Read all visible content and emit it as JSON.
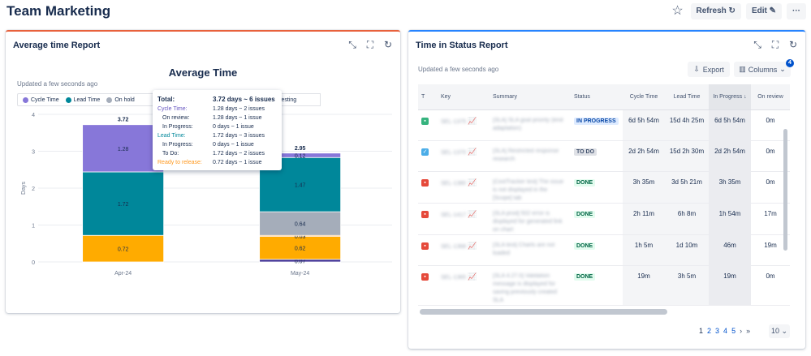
{
  "page": {
    "title": "Team Marketing",
    "refresh_label": "Refresh",
    "refresh_icon": "↻",
    "edit_label": "Edit",
    "edit_icon": "✎",
    "more_label": "···",
    "star_icon": "☆"
  },
  "average_report": {
    "panel_title": "Average time Report",
    "updated": "Updated a few seconds ago",
    "icons": [
      "collapse-icon",
      "fullscreen-icon",
      "refresh-icon"
    ],
    "legend": [
      {
        "label": "Cycle Time",
        "color": "#8777d9"
      },
      {
        "label": "Lead Time",
        "color": "#00879a"
      },
      {
        "label": "On hold",
        "color": "#a5adba"
      }
    ],
    "legend_last": {
      "label": "Testing",
      "color": "#403294"
    },
    "tooltip": {
      "total_label": "Total:",
      "total_value": "3.72 days ~ 6 issues",
      "rows": [
        {
          "label": "Cycle Time:",
          "value": "1.28 days ~ 2 issues",
          "kind": "cycle"
        },
        {
          "label": "On review:",
          "value": "1.28 days ~ 1 issue",
          "kind": "sub"
        },
        {
          "label": "In Progress:",
          "value": "0 days ~ 1 issue",
          "kind": "sub"
        },
        {
          "label": "Lead Time:",
          "value": "1.72 days ~ 3 issues",
          "kind": "lead"
        },
        {
          "label": "In Progress:",
          "value": "0 days ~ 1 issue",
          "kind": "sub"
        },
        {
          "label": "To Do:",
          "value": "1.72 days ~ 2 issues",
          "kind": "sub"
        },
        {
          "label": "Ready to release:",
          "value": "0.72 days ~ 1 issue",
          "kind": "ready"
        }
      ]
    }
  },
  "chart_data": {
    "type": "bar",
    "stacked": true,
    "title": "Average Time",
    "ylabel": "Days",
    "xlabel": "",
    "ylim": [
      0,
      4
    ],
    "yticks": [
      "0",
      "1",
      "2",
      "3",
      "4"
    ],
    "categories": [
      "Apr-24",
      "May-24"
    ],
    "totals": [
      "3.72",
      "2.95"
    ],
    "series": [
      {
        "name": "Testing",
        "color": "#403294",
        "values": [
          0,
          0.07
        ],
        "labels": [
          "",
          "0.07"
        ]
      },
      {
        "name": "Ready to release",
        "color": "#ffab00",
        "values": [
          0.72,
          0.62
        ],
        "labels": [
          "0.72",
          "0.62"
        ]
      },
      {
        "name": "In Progress",
        "color": "#ff991f",
        "values": [
          0,
          0.03
        ],
        "labels": [
          "0",
          "0.03"
        ]
      },
      {
        "name": "On hold",
        "color": "#a5adba",
        "values": [
          0,
          0.64
        ],
        "labels": [
          "",
          "0.64"
        ]
      },
      {
        "name": "Lead Time",
        "color": "#00879a",
        "values": [
          1.72,
          1.47
        ],
        "labels": [
          "1.72",
          "1.47"
        ]
      },
      {
        "name": "Cycle Time",
        "color": "#8777d9",
        "values": [
          1.28,
          0.12
        ],
        "labels": [
          "1.28",
          "0.12"
        ]
      }
    ]
  },
  "status_report": {
    "panel_title": "Time in Status Report",
    "updated": "Updated a few seconds ago",
    "export_label": "Export",
    "columns_label": "Columns",
    "columns_badge": "4",
    "headers": [
      "T",
      "Key",
      "Summary",
      "Status",
      "Cycle Time",
      "Lead Time",
      "In Progress",
      "On review"
    ],
    "rows": [
      {
        "type": "story",
        "key": "SEL-1375",
        "summary": "[SLA] SLA goal priority (limit adaptation)",
        "status": "IN PROGRESS",
        "cycle": "6d 5h 54m",
        "lead": "15d 4h 25m",
        "inprog": "6d 5h 54m",
        "onreview": "0m"
      },
      {
        "type": "task",
        "key": "SEL-1370",
        "summary": "[SLA] Restricted response research",
        "status": "TO DO",
        "cycle": "2d 2h 54m",
        "lead": "15d 2h 30m",
        "inprog": "2d 2h 54m",
        "onreview": "0m"
      },
      {
        "type": "bug",
        "key": "SEL-1380",
        "summary": "[CostTracker test] The issue is not displayed in the [Scope] tab",
        "status": "DONE",
        "cycle": "3h 35m",
        "lead": "3d 5h 21m",
        "inprog": "3h 35m",
        "onreview": "0m"
      },
      {
        "type": "bug",
        "key": "SEL-1417",
        "summary": "[SLA prod] 502 error is displayed for generated link on chart",
        "status": "DONE",
        "cycle": "2h 11m",
        "lead": "6h 8m",
        "inprog": "1h 54m",
        "onreview": "17m"
      },
      {
        "type": "bug",
        "key": "SEL-1368",
        "summary": "[SLA test] Charts are not loaded",
        "status": "DONE",
        "cycle": "1h 5m",
        "lead": "1d 10m",
        "inprog": "46m",
        "onreview": "19m"
      },
      {
        "type": "bug",
        "key": "SEL-1365",
        "summary": "[SLA 4.27.0] Validation message is displayed for saving previously created SLA",
        "status": "DONE",
        "cycle": "19m",
        "lead": "3h 5m",
        "inprog": "19m",
        "onreview": "0m"
      }
    ],
    "pages": [
      "1",
      "2",
      "3",
      "4",
      "5"
    ],
    "next_label": "›",
    "last_label": "»",
    "page_size": "10",
    "page_size_caret": "⌄"
  }
}
